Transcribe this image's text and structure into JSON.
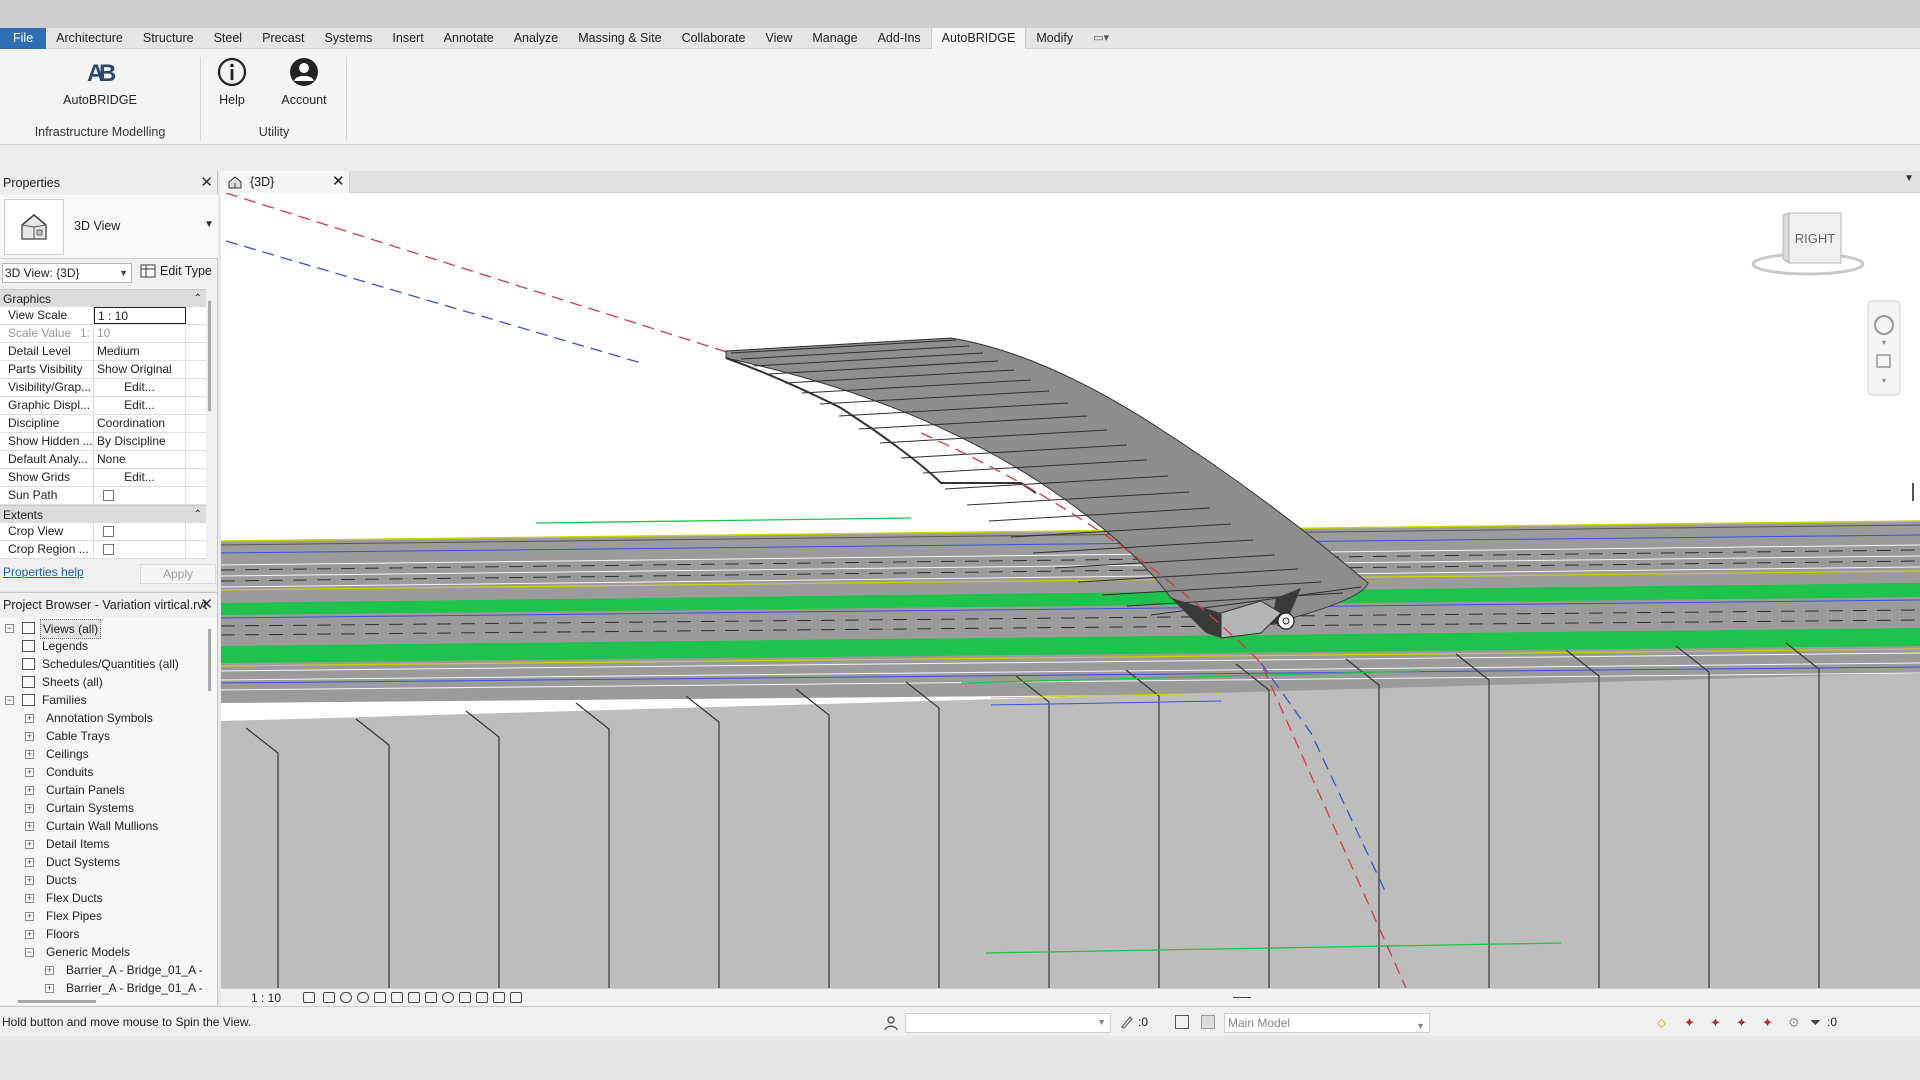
{
  "menu": {
    "file": "File",
    "tabs": [
      "Architecture",
      "Structure",
      "Steel",
      "Precast",
      "Systems",
      "Insert",
      "Annotate",
      "Analyze",
      "Massing & Site",
      "Collaborate",
      "View",
      "Manage",
      "Add-Ins",
      "AutoBRIDGE",
      "Modify"
    ],
    "active_tab": "AutoBRIDGE",
    "quick_access": "▭▾"
  },
  "ribbon": {
    "autobridge_label": "AutoBRIDGE",
    "help_label": "Help",
    "account_label": "Account",
    "panel_infra": "Infrastructure Modelling",
    "panel_utility": "Utility"
  },
  "properties": {
    "title": "Properties",
    "type_name": "3D View",
    "view_selector": "3D View: {3D}",
    "edit_type": "Edit Type",
    "groups": {
      "graphics": "Graphics",
      "extents": "Extents"
    },
    "rows": {
      "view_scale": {
        "k": "View Scale",
        "v": "1 : 10"
      },
      "scale_value": {
        "k": "Scale Value",
        "k2": "1:",
        "v": "10"
      },
      "detail_level": {
        "k": "Detail Level",
        "v": "Medium"
      },
      "parts_visibility": {
        "k": "Parts Visibility",
        "v": "Show Original"
      },
      "visibility_graphics": {
        "k": "Visibility/Grap...",
        "v": "Edit..."
      },
      "graphic_display": {
        "k": "Graphic Displ...",
        "v": "Edit..."
      },
      "discipline": {
        "k": "Discipline",
        "v": "Coordination"
      },
      "show_hidden": {
        "k": "Show Hidden ...",
        "v": "By Discipline"
      },
      "default_analysis": {
        "k": "Default Analy...",
        "v": "None"
      },
      "show_grids": {
        "k": "Show Grids",
        "v": "Edit..."
      },
      "sun_path": {
        "k": "Sun Path"
      },
      "crop_view": {
        "k": "Crop View"
      },
      "crop_region": {
        "k": "Crop Region ..."
      }
    },
    "help_link": "Properties help",
    "apply": "Apply"
  },
  "browser": {
    "title": "Project Browser - Variation virtical.rvt",
    "items": [
      {
        "label": "Views (all)"
      },
      {
        "label": "Legends"
      },
      {
        "label": "Schedules/Quantities (all)"
      },
      {
        "label": "Sheets (all)"
      },
      {
        "label": "Families"
      },
      {
        "label": "Annotation Symbols"
      },
      {
        "label": "Cable Trays"
      },
      {
        "label": "Ceilings"
      },
      {
        "label": "Conduits"
      },
      {
        "label": "Curtain Panels"
      },
      {
        "label": "Curtain Systems"
      },
      {
        "label": "Curtain Wall Mullions"
      },
      {
        "label": "Detail Items"
      },
      {
        "label": "Duct Systems"
      },
      {
        "label": "Ducts"
      },
      {
        "label": "Flex Ducts"
      },
      {
        "label": "Flex Pipes"
      },
      {
        "label": "Floors"
      },
      {
        "label": "Generic Models"
      },
      {
        "label": "Barrier_A - Bridge_01_A -"
      },
      {
        "label": "Barrier_A - Bridge_01_A -"
      }
    ]
  },
  "view_tab": {
    "label": "{3D}"
  },
  "viewcube": {
    "face": "RIGHT"
  },
  "view_control": {
    "scale": "1 : 10"
  },
  "status": {
    "message": "Hold button and move mouse to Spin the View.",
    "zero1": ":0",
    "model": "Main Model",
    "zero2": ":0"
  },
  "colors": {
    "accent_file": "#2f6db5",
    "green_stripe": "#1fc24a",
    "road_gray": "#9b9b9b",
    "red_dashed": "#d43a4a",
    "blue_dashed": "#3b4fd8"
  }
}
